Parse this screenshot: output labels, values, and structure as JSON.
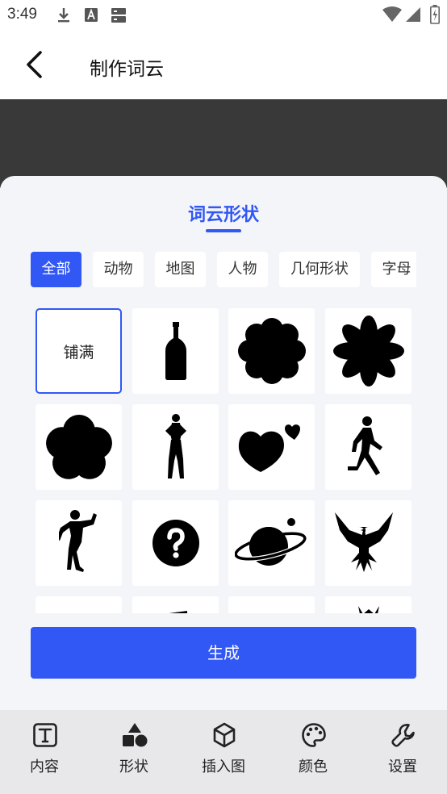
{
  "status_bar": {
    "time": "3:49",
    "icons": [
      "download-icon",
      "font-icon",
      "storage-icon",
      "wifi-icon",
      "signal-icon",
      "battery-charging-icon"
    ]
  },
  "header": {
    "title": "制作词云",
    "back_icon": "back-arrow-icon"
  },
  "sheet": {
    "title": "词云形状",
    "categories": [
      {
        "label": "全部",
        "active": true
      },
      {
        "label": "动物",
        "active": false
      },
      {
        "label": "地图",
        "active": false
      },
      {
        "label": "人物",
        "active": false
      },
      {
        "label": "几何形状",
        "active": false
      },
      {
        "label": "字母",
        "active": false
      }
    ],
    "shapes": [
      {
        "name": "fill",
        "label": "铺满",
        "selected": true
      },
      {
        "name": "bottle",
        "icon": "bottle-icon"
      },
      {
        "name": "cloud-flower",
        "icon": "cloud-flower-icon"
      },
      {
        "name": "eight-petal-flower",
        "icon": "flower-icon"
      },
      {
        "name": "five-petal-flower",
        "icon": "five-petal-flower-icon"
      },
      {
        "name": "standing-woman",
        "icon": "woman-silhouette-icon"
      },
      {
        "name": "hearts",
        "icon": "hearts-icon"
      },
      {
        "name": "walking-person",
        "icon": "walking-person-icon"
      },
      {
        "name": "dancing-person",
        "icon": "dancer-silhouette-icon"
      },
      {
        "name": "question-mark",
        "icon": "question-circle-icon"
      },
      {
        "name": "planet",
        "icon": "planet-icon"
      },
      {
        "name": "eagle",
        "icon": "eagle-icon"
      }
    ],
    "generate_label": "生成"
  },
  "bottom_nav": [
    {
      "label": "内容",
      "icon": "text-box-icon"
    },
    {
      "label": "形状",
      "icon": "shapes-icon"
    },
    {
      "label": "插入图",
      "icon": "cube-icon"
    },
    {
      "label": "颜色",
      "icon": "palette-icon"
    },
    {
      "label": "设置",
      "icon": "wrench-icon"
    }
  ],
  "colors": {
    "accent": "#3157f5",
    "sheet_bg": "#f4f5f9",
    "backdrop": "#393939",
    "nav_bg": "#e8e8ea"
  }
}
